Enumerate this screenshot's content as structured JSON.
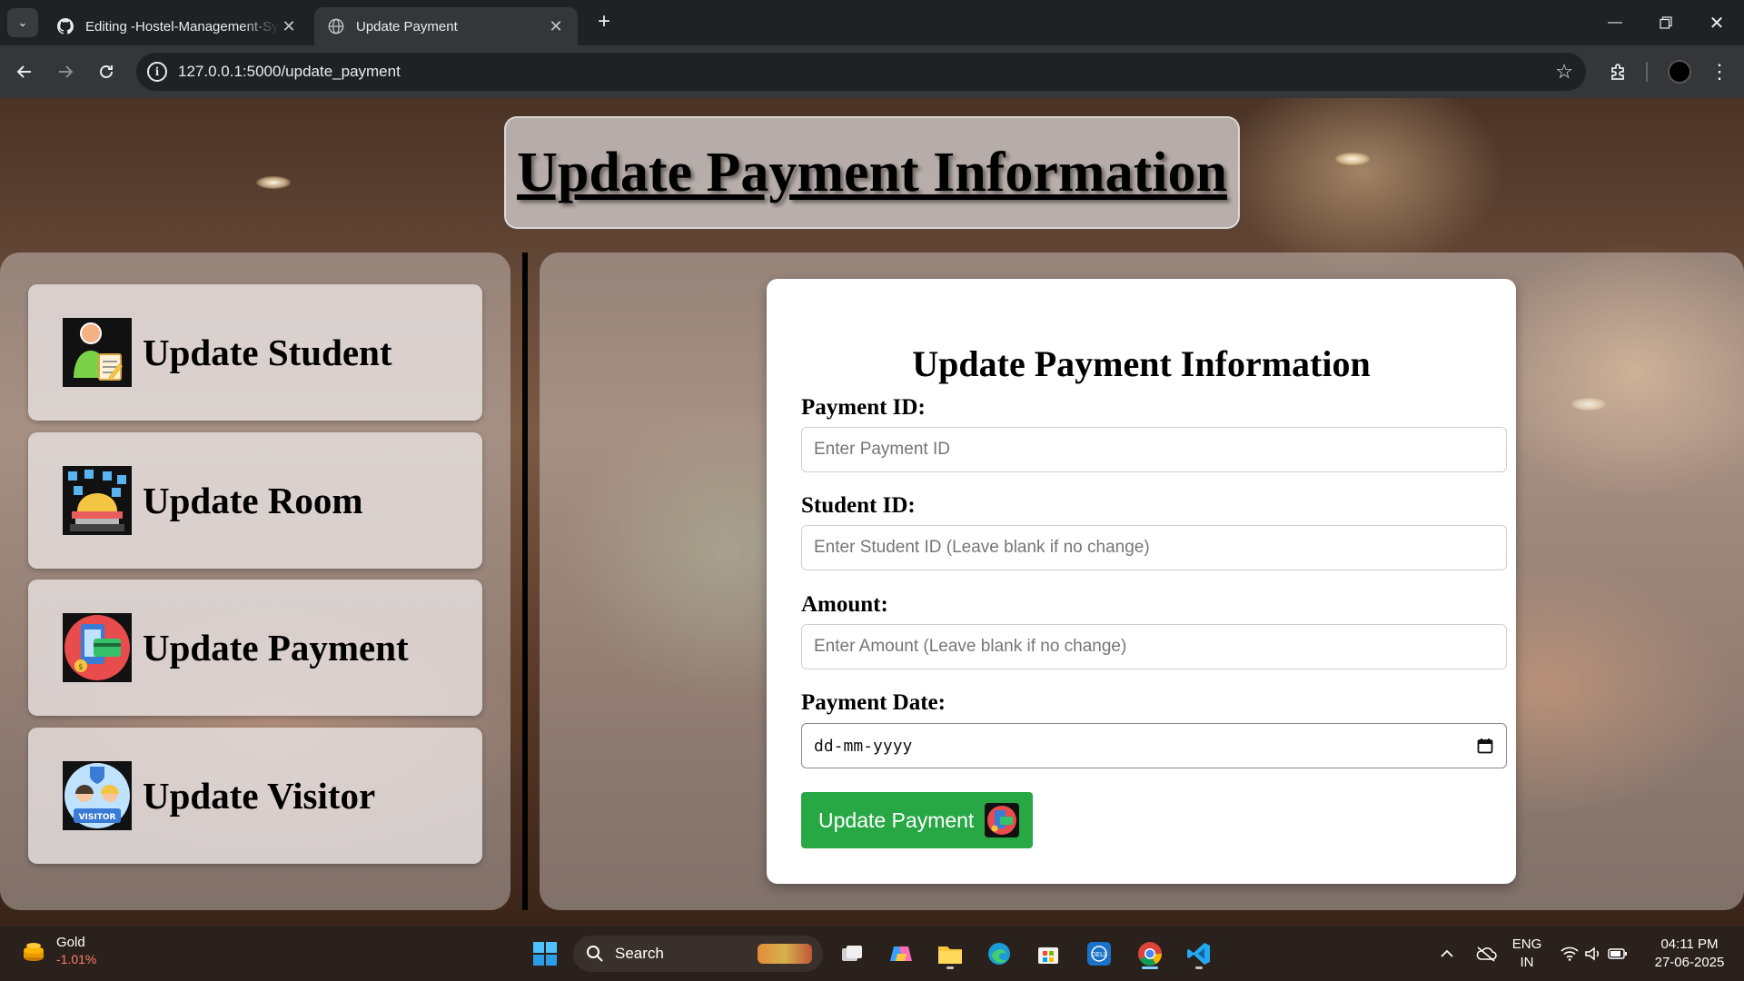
{
  "browser": {
    "tabs": [
      {
        "title": "Editing -Hostel-Management-System",
        "active": false
      },
      {
        "title": "Update Payment",
        "active": true
      }
    ],
    "url": "127.0.0.1:5000/update_payment"
  },
  "page": {
    "header_title": "Update Payment Information",
    "sidebar": [
      {
        "label": "Update Student",
        "icon": "student-icon"
      },
      {
        "label": "Update Room",
        "icon": "room-icon"
      },
      {
        "label": "Update Payment",
        "icon": "payment-icon"
      },
      {
        "label": "Update Visitor",
        "icon": "visitor-icon"
      }
    ],
    "form": {
      "title": "Update Payment Information",
      "payment_id_label": "Payment ID:",
      "payment_id_placeholder": "Enter Payment ID",
      "student_id_label": "Student ID:",
      "student_id_placeholder": "Enter Student ID (Leave blank if no change)",
      "amount_label": "Amount:",
      "amount_placeholder": "Enter Amount (Leave blank if no change)",
      "payment_date_label": "Payment Date:",
      "payment_date_value": "dd-mm-yyyy",
      "submit_label": "Update Payment"
    }
  },
  "taskbar": {
    "widget_title": "Gold",
    "widget_value": "-1.01%",
    "search_label": "Search",
    "lang_top": "ENG",
    "lang_bottom": "IN",
    "time": "04:11 PM",
    "date": "27-06-2025"
  },
  "colors": {
    "submit_button": "#28a745",
    "chrome_dark": "#202124",
    "chrome_toolbar": "#35363a"
  }
}
